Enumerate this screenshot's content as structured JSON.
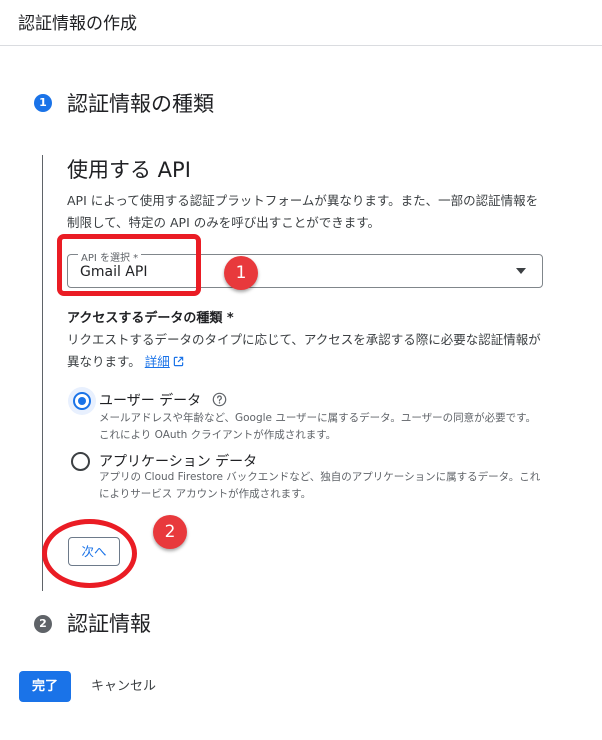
{
  "header": {
    "title": "認証情報の作成"
  },
  "steps": [
    {
      "number": "1",
      "title": "認証情報の種類"
    },
    {
      "number": "2",
      "title": "認証情報"
    }
  ],
  "api_section": {
    "title": "使用する API",
    "description": "API によって使用する認証プラットフォームが異なります。また、一部の認証情報を制限して、特定の API のみを呼び出すことができます。",
    "select": {
      "label": "API を選択 *",
      "value": "Gmail API"
    }
  },
  "data_section": {
    "title": "アクセスするデータの種類 *",
    "description": "リクエストするデータのタイプに応じて、アクセスを承認する際に必要な認証情報が異なります。",
    "learn_more": "詳細",
    "options": [
      {
        "label": "ユーザー データ",
        "description": "メールアドレスや年齢など、Google ユーザーに属するデータ。ユーザーの同意が必要です。これにより OAuth クライアントが作成されます。",
        "selected": true
      },
      {
        "label": "アプリケーション データ",
        "description": "アプリの Cloud Firestore バックエンドなど、独自のアプリケーションに属するデータ。これによりサービス アカウントが作成されます。",
        "selected": false
      }
    ]
  },
  "buttons": {
    "next": "次へ",
    "done": "完了",
    "cancel": "キャンセル"
  },
  "annotations": [
    {
      "number": "1"
    },
    {
      "number": "2"
    }
  ],
  "colors": {
    "primary": "#1a73e8",
    "annotation": "#ea1c24",
    "text": "#202124",
    "muted": "#5f6368"
  },
  "icons": {
    "help": "help-circle-icon",
    "external_link": "open-in-new-icon",
    "dropdown": "arrow-drop-down-icon"
  }
}
